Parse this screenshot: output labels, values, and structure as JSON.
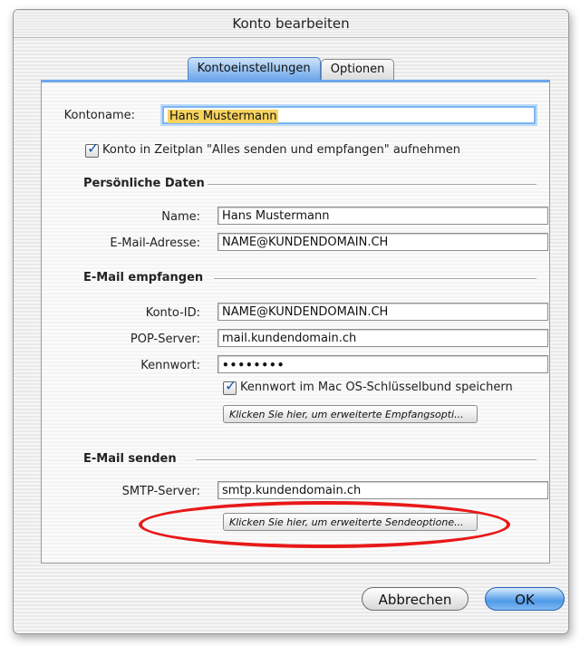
{
  "window": {
    "title": "Konto bearbeiten"
  },
  "tabs": [
    {
      "label": "Kontoeinstellungen",
      "active": true
    },
    {
      "label": "Optionen",
      "active": false
    }
  ],
  "account": {
    "name_label": "Kontoname:",
    "name_value": "Hans Mustermann",
    "schedule_checkbox_label": "Konto in Zeitplan \"Alles senden und empfangen\" aufnehmen",
    "schedule_checked": true
  },
  "personal": {
    "heading": "Persönliche Daten",
    "name_label": "Name:",
    "name_value": "Hans Mustermann",
    "email_label": "E-Mail-Adresse:",
    "email_value": "NAME@KUNDENDOMAIN.CH"
  },
  "receive": {
    "heading": "E-Mail empfangen",
    "account_id_label": "Konto-ID:",
    "account_id_value": "NAME@KUNDENDOMAIN.CH",
    "pop_label": "POP-Server:",
    "pop_value": "mail.kundendomain.ch",
    "password_label": "Kennwort:",
    "password_value": "••••••••",
    "keychain_label": "Kennwort im Mac OS-Schlüsselbund speichern",
    "keychain_checked": true,
    "advanced_button": "Klicken Sie hier, um erweiterte Empfangsopti..."
  },
  "send": {
    "heading": "E-Mail senden",
    "smtp_label": "SMTP-Server:",
    "smtp_value": "smtp.kundendomain.ch",
    "advanced_button": "Klicken Sie hier, um erweiterte Sendeoptione..."
  },
  "footer": {
    "cancel_label": "Abbrechen",
    "ok_label": "OK"
  },
  "colors": {
    "accent": "#6ea7ea",
    "highlight_annotation": "#e81919",
    "selection": "#f7d35e"
  }
}
